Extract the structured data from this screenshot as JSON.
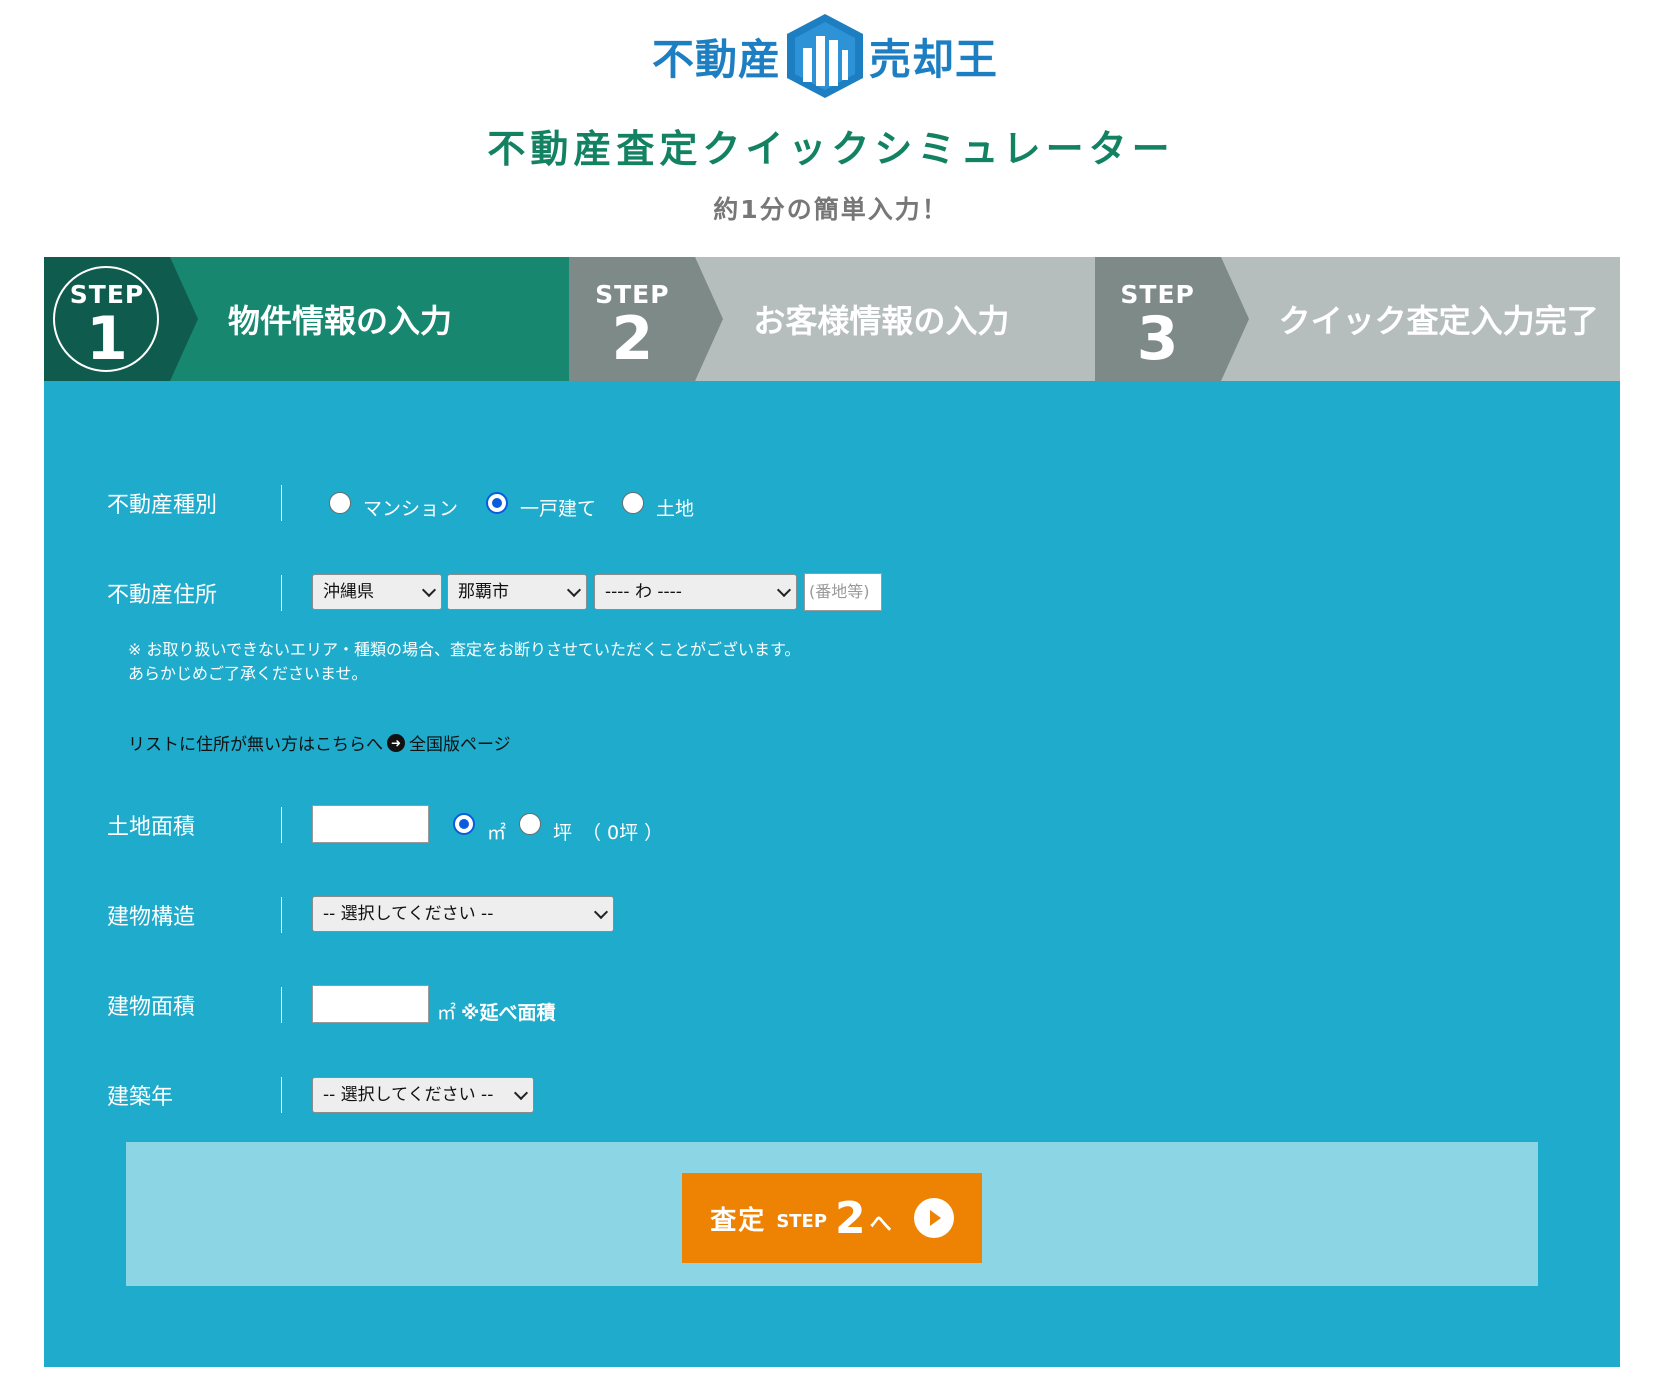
{
  "header": {
    "logo_left": "不動産",
    "logo_right": "売却王",
    "title": "不動産査定クイックシミュレーター",
    "subtitle": "約1分の簡単入力！"
  },
  "steps": [
    {
      "word": "STEP",
      "number": "1",
      "label": "物件情報の入力",
      "active": true
    },
    {
      "word": "STEP",
      "number": "2",
      "label": "お客様情報の入力",
      "active": false
    },
    {
      "word": "STEP",
      "number": "3",
      "label": "クイック査定入力完了",
      "active": false
    }
  ],
  "form": {
    "property_type": {
      "label": "不動産種別",
      "options": [
        "マンション",
        "一戸建て",
        "土地"
      ],
      "selected": "一戸建て"
    },
    "address": {
      "label": "不動産住所",
      "prefecture": "沖縄県",
      "city": "那覇市",
      "town": "---- わ ----",
      "street_placeholder": "(番地等)",
      "note_line1": "※ お取り扱いできないエリア・種類の場合、査定をお断りさせていただくことがございます。",
      "note_line2": "あらかじめご了承くださいませ。",
      "list_note": "リストに住所が無い方はこちらへ",
      "list_link": "全国版ページ"
    },
    "land_area": {
      "label": "土地面積",
      "value": "",
      "unit_sqm": "㎡",
      "unit_tsubo": "坪",
      "selected_unit": "㎡",
      "conversion": "（ 0坪 ）"
    },
    "structure": {
      "label": "建物構造",
      "selected": "-- 選択してください --"
    },
    "building_area": {
      "label": "建物面積",
      "value": "",
      "unit": "㎡",
      "note": "※延べ面積"
    },
    "built_year": {
      "label": "建築年",
      "selected": "-- 選択してください --"
    }
  },
  "submit": {
    "text1": "査定",
    "text2": "STEP",
    "text3": "2",
    "text4": "へ"
  },
  "colors": {
    "panel": "#1eabcc",
    "step_active": "#17876f",
    "step_inactive": "#b6bebd",
    "button": "#ee8203",
    "title": "#138263",
    "logo": "#1d7fc2"
  }
}
